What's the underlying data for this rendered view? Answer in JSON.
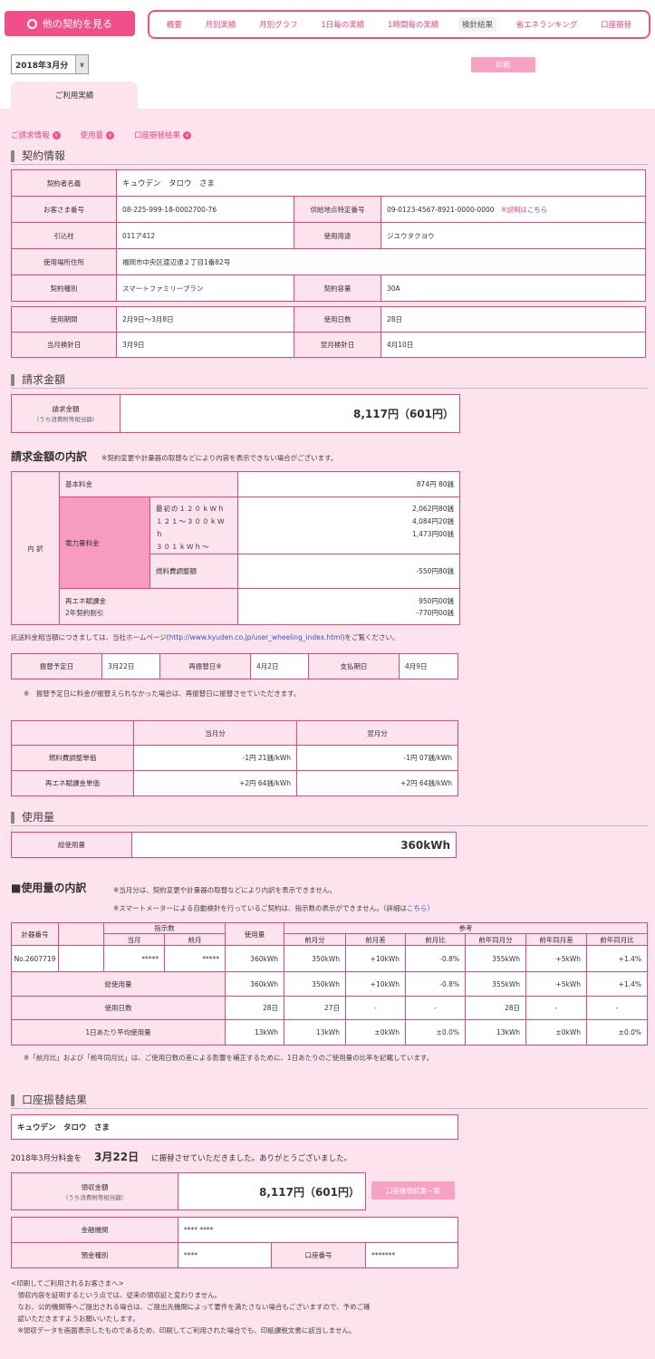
{
  "top": {
    "other_contracts": "他の契約を見る",
    "tabs": [
      "概要",
      "月別実績",
      "月別グラフ",
      "1日毎の実績",
      "1時間毎の実績",
      "検針結果",
      "省エネランキング",
      "口座振替"
    ],
    "active_tab": "検針結果",
    "month": "2018年3月分",
    "print": "印刷",
    "usage_tab": "ご利用実績"
  },
  "anchors": [
    "ご請求情報",
    "使用量",
    "口座振替結果"
  ],
  "contract": {
    "title": "契約情報",
    "name_label": "契約者名義",
    "name": "キュウデン　タロウ　さま",
    "customer_no_label": "お客さま番号",
    "customer_no": "08-225-999-18-0002700-76",
    "supply_label": "供給地点特定番号",
    "supply_no": "09-0123-4567-8921-0000-0000",
    "supply_note": "※説明は",
    "supply_link": "こちら",
    "intro_label": "引込柱",
    "intro": "011ア412",
    "use_label": "使用用途",
    "use": "ジユウタクヨウ",
    "addr_label": "使用場所住所",
    "addr": "福岡市中央区渡辺通２丁目1番82号",
    "kind_label": "契約種別",
    "kind": "スマートファミリープラン",
    "cap_label": "契約容量",
    "cap": "30A",
    "period_label": "使用期間",
    "period": "2月9日～3月8日",
    "days_label": "使用日数",
    "days": "28日",
    "meter_label": "当月検針日",
    "meter": "3月9日",
    "next_label": "翌月検針日",
    "next": "4月10日"
  },
  "billing": {
    "title": "請求金額",
    "label": "請求金額",
    "sublabel": "（うち消費税等相当額）",
    "amount": "8,117円（601円）"
  },
  "breakdown": {
    "title": "請求金額の内訳",
    "note": "※契約変更や計量器の取替などにより内容を表示できない場合がございます。",
    "side": "内 訳",
    "base_label": "基本料金",
    "base": "874円 80銭",
    "power_label": "電力量料金",
    "tier1": "最初の１２０ｋＷｈ",
    "tier2": "１２１～３００ｋＷｈ",
    "tier3": "３０１ｋＷｈ～",
    "v1": "2,062円80銭",
    "v2": "4,084円20銭",
    "v3": "1,473円00銭",
    "fuel_label": "燃料費調整額",
    "fuel": "-550円80銭",
    "renew_label": "再エネ賦課金",
    "renew": "950円00銭",
    "discount_label": "2年契約割引",
    "discount": "-770円00銭",
    "wheeling_pre": "託送料金相当額につきましては、当社ホームページ(",
    "wheeling_link": "http://www.kyuden.co.jp/user_wheeling_index.html",
    "wheeling_post": ")をご覧ください。"
  },
  "schedule": {
    "plan_label": "振替予定日",
    "plan": "3月22日",
    "retry_label": "再振替日※",
    "retry": "4月2日",
    "due_label": "支払期日",
    "due": "4月9日",
    "note": "※　振替予定日に料金が振替えられなかった場合は、再振替日に振替させていただきます。"
  },
  "unit": {
    "h_cur": "当月分",
    "h_next": "翌月分",
    "fuel_label": "燃料費調整単価",
    "fuel_cur": "-1円 21銭/kWh",
    "fuel_next": "-1円 07銭/kWh",
    "renew_label": "再エネ賦課金単価",
    "renew_cur": "+2円 64銭/kWh",
    "renew_next": "+2円 64銭/kWh"
  },
  "usage": {
    "title": "使用量",
    "label": "総使用量",
    "amount": "360kWh"
  },
  "usage_bd": {
    "title": "■使用量の内訳",
    "note1": "※当月分は、契約変更や計量器の取替などにより内訳を表示できません。",
    "note2_pre": "※スマートメーターによる自動検針を行っているご契約は、指示数の表示ができません。（詳細は",
    "note2_link": "こちら",
    "note2_post": "）",
    "h_meter": "計器番号",
    "h_reading": "指示数",
    "h_cur": "当月",
    "h_prev": "前月",
    "h_use": "使用量",
    "h_ref": "参考",
    "ref_cols": [
      "前月分",
      "前月差",
      "前月比",
      "前年同月分",
      "前年同月差",
      "前年同月比"
    ],
    "meter_no": "No.2607719",
    "r_cur": "*****",
    "r_prev": "*****",
    "r1": [
      "360kWh",
      "350kWh",
      "+10kWh",
      "-0.8%",
      "355kWh",
      "+5kWh",
      "+1.4%"
    ],
    "r2_label": "総使用量",
    "r2": [
      "360kWh",
      "350kWh",
      "+10kWh",
      "-0.8%",
      "355kWh",
      "+5kWh",
      "+1.4%"
    ],
    "r3_label": "使用日数",
    "r3": [
      "28日",
      "27日",
      "-",
      "-",
      "28日",
      "-",
      "-"
    ],
    "r4_label": "1日あたり平均使用量",
    "r4": [
      "13kWh",
      "13kWh",
      "±0kWh",
      "±0.0%",
      "13kWh",
      "±0kWh",
      "±0.0%"
    ],
    "footnote": "※「前月比」および「前年同月比」は、ご使用日数の差による影響を補正するために、1日あたりのご使用量の比率を記載しています。"
  },
  "transfer": {
    "title": "口座振替結果",
    "name": "キュウデン　タロウ　さま",
    "msg_pre": "2018年3月分料金を",
    "msg_date": "3月22日",
    "msg_post": "に振替させていただきました。ありがとうございました。",
    "label": "領収金額",
    "sublabel": "（うち消費税等相当額）",
    "amount": "8,117円（601円）",
    "list_btn": "口座振替結果一覧",
    "bank_label": "金融機関",
    "bank": "**** ****",
    "type_label": "預金種別",
    "type": "****",
    "acct_label": "口座番号",
    "acct": "*******",
    "notes": [
      "<印刷してご利用されるお客さまへ>",
      "　領収内容を証明するという点では、従来の領収証と変わりません。",
      "　なお、公的機関等へご提出される場合は、ご提出先機関によって要件を満たさない場合もございますので、予めご確",
      "　認いただきますようお願いいたします。",
      "　※領収データを画面表示したものであるため、印刷してご利用された場合でも、印紙課税文書に該当しません。"
    ]
  }
}
